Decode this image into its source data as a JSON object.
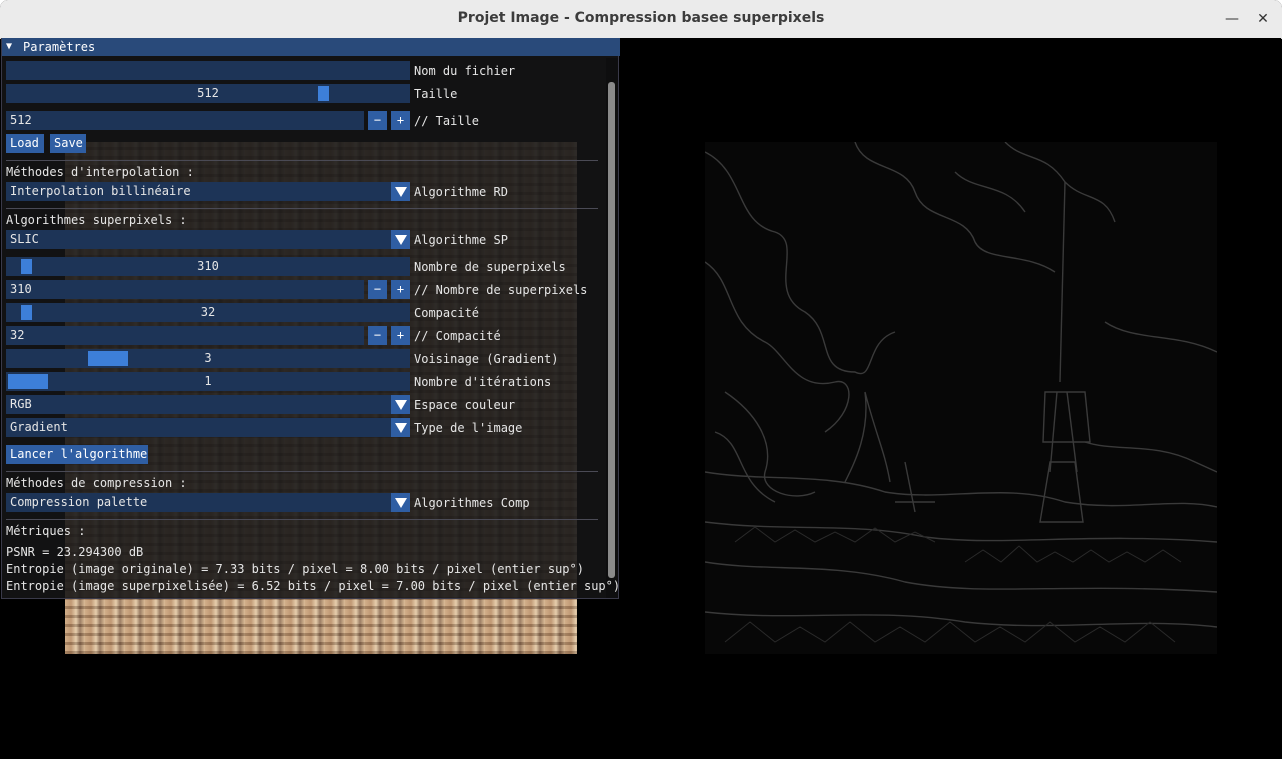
{
  "window": {
    "title": "Projet Image - Compression basee superpixels",
    "minimize": "—",
    "close": "✕"
  },
  "panel": {
    "title": "Paramètres",
    "filename": {
      "value": "",
      "label": "Nom du fichier"
    },
    "size_slider": {
      "value": "512",
      "label": "Taille",
      "fraction": 0.78
    },
    "size_input": {
      "value": "512",
      "label": "// Taille",
      "minus": "−",
      "plus": "+"
    },
    "load_label": "Load",
    "save_label": "Save",
    "interp_heading": "Méthodes d'interpolation :",
    "interp_combo": {
      "value": "Interpolation billinéaire",
      "label": "Algorithme RD"
    },
    "sp_heading": "Algorithmes superpixels :",
    "sp_combo": {
      "value": "SLIC",
      "label": "Algorithme SP"
    },
    "nb_sp_slider": {
      "value": "310",
      "label": "Nombre de superpixels",
      "fraction": 0.03
    },
    "nb_sp_input": {
      "value": "310",
      "label": "// Nombre de superpixels",
      "minus": "−",
      "plus": "+"
    },
    "compact_slider": {
      "value": "32",
      "label": "Compacité",
      "fraction": 0.03
    },
    "compact_input": {
      "value": "32",
      "label": "// Compacité",
      "minus": "−",
      "plus": "+"
    },
    "neighbor_slider": {
      "value": "3",
      "label": "Voisinage (Gradient)",
      "fraction": 0.2
    },
    "iter_slider": {
      "value": "1",
      "label": "Nombre d'itérations",
      "fraction": 0.0
    },
    "color_combo": {
      "value": "RGB",
      "label": "Espace couleur"
    },
    "imgtype_combo": {
      "value": "Gradient",
      "label": "Type de l'image"
    },
    "run_label": "Lancer l'algorithme",
    "comp_heading": "Méthodes de compression :",
    "comp_combo": {
      "value": "Compression palette",
      "label": "Algorithmes Comp"
    },
    "metrics_heading": "Métriques :",
    "psnr": "PSNR = 23.294300 dB",
    "entropy_orig": "Entropie (image originale) = 7.33 bits / pixel = 8.00 bits / pixel (entier sup°)",
    "entropy_sp": "Entropie (image superpixelisée) = 6.52 bits / pixel = 7.00 bits / pixel (entier sup°)"
  },
  "colors": {
    "title_bar": "#294a7a",
    "frame": "#1d3457",
    "button": "#2f5ea3",
    "slider_grab": "#3d7fd9"
  }
}
